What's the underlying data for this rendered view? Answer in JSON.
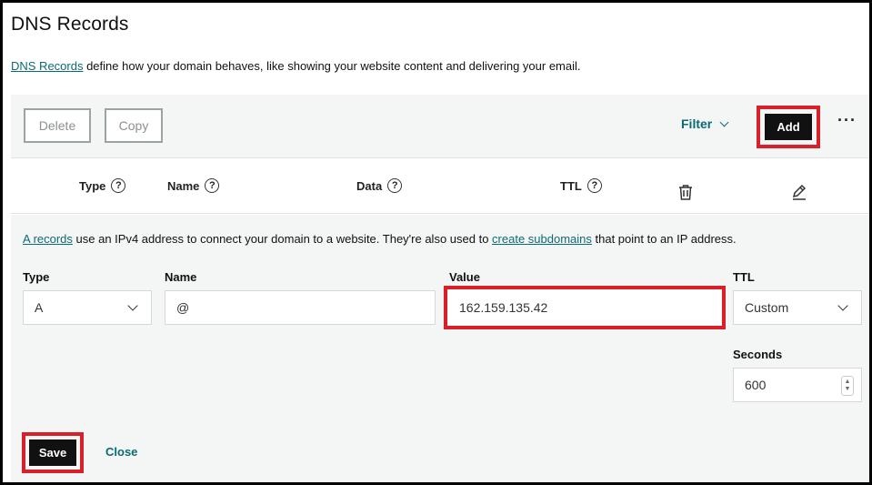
{
  "page": {
    "title": "DNS Records",
    "intro_link": "DNS Records",
    "intro_text": " define how your domain behaves, like showing your website content and delivering your email."
  },
  "toolbar": {
    "delete_label": "Delete",
    "copy_label": "Copy",
    "filter_label": "Filter",
    "add_label": "Add",
    "more_label": "···"
  },
  "columns": {
    "type": "Type",
    "name": "Name",
    "data": "Data",
    "ttl": "TTL"
  },
  "editor": {
    "desc_link1": "A records",
    "desc_text1": " use an IPv4 address to connect your domain to a website. They're also used to ",
    "desc_link2": "create subdomains",
    "desc_text2": " that point to an IP address.",
    "type_label": "Type",
    "type_value": "A",
    "name_label": "Name",
    "name_value": "@",
    "value_label": "Value",
    "value_value": "162.159.135.42",
    "ttl_label": "TTL",
    "ttl_value": "Custom",
    "seconds_label": "Seconds",
    "seconds_value": "600",
    "save_label": "Save",
    "close_label": "Close"
  },
  "colors": {
    "accent_teal": "#0b6b74",
    "highlight_red": "#d81f2a",
    "dark_button": "#111111"
  }
}
